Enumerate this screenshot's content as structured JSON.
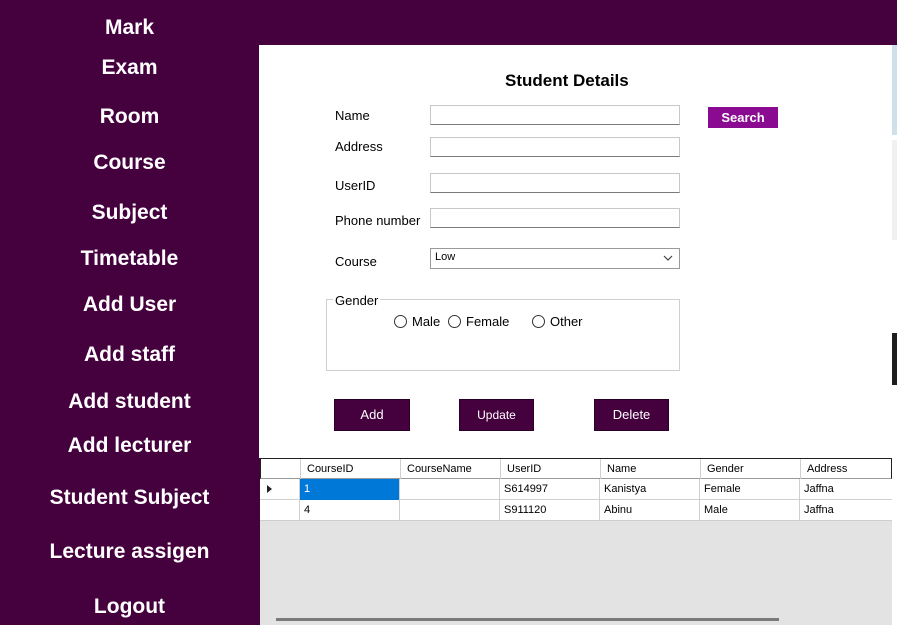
{
  "sidebar": {
    "items": [
      {
        "label": "Mark"
      },
      {
        "label": "Exam"
      },
      {
        "label": "Room"
      },
      {
        "label": "Course"
      },
      {
        "label": "Subject"
      },
      {
        "label": "Timetable"
      },
      {
        "label": "Add User"
      },
      {
        "label": "Add staff"
      },
      {
        "label": "Add student"
      },
      {
        "label": "Add lecturer"
      },
      {
        "label": "Student Subject"
      },
      {
        "label": "Lecture assigen"
      },
      {
        "label": "Logout"
      }
    ]
  },
  "form": {
    "title": "Student Details",
    "fields": {
      "name": {
        "label": "Name",
        "value": ""
      },
      "address": {
        "label": "Address",
        "value": ""
      },
      "userid": {
        "label": "UserID",
        "value": ""
      },
      "phone": {
        "label": "Phone number",
        "value": ""
      },
      "course": {
        "label": "Course",
        "value": "Low"
      }
    },
    "search_label": "Search",
    "gender": {
      "title": "Gender",
      "options": [
        "Male",
        "Female",
        "Other"
      ]
    },
    "buttons": {
      "add": "Add",
      "update": "Update",
      "delete": "Delete"
    }
  },
  "grid": {
    "columns": [
      "CourseID",
      "CourseName",
      "UserID",
      "Name",
      "Gender",
      "Address"
    ],
    "rows": [
      {
        "courseid": "1",
        "coursename": "",
        "userid": "S614997",
        "name": "Kanistya",
        "gender": "Female",
        "address": "Jaffna",
        "selected": true
      },
      {
        "courseid": "4",
        "coursename": "",
        "userid": "S911120",
        "name": "Abinu",
        "gender": "Male",
        "address": "Jaffna",
        "selected": false
      }
    ]
  },
  "colors": {
    "sidebar_bg": "#44013e",
    "search_button": "#8a0a91",
    "selection": "#0078d7"
  },
  "icons": {
    "combo_dropdown": "chevron-down-icon",
    "row_indicator": "row-arrow-icon"
  }
}
